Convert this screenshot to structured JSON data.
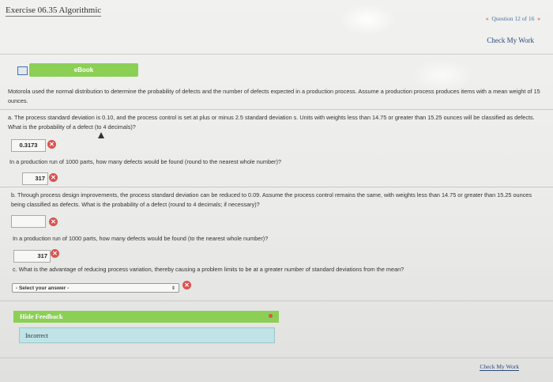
{
  "header": {
    "title": "Exercise 06.35 Algorithmic",
    "question_nav": {
      "prev": "«",
      "label": "Question 12 of 16",
      "next": "»"
    },
    "check_my_work": "Check My Work"
  },
  "ebook": {
    "label": "eBook"
  },
  "intro": "Motorola used the normal distribution to determine the probability of defects and the number of defects expected in a production process. Assume a production process produces items with a mean weight of 15 ounces.",
  "part_a": {
    "text": "a. The process standard deviation is 0.10, and the process control is set at plus or minus 2.5 standard deviation s. Units with weights less than 14.75 or greater than 15.25 ounces will be classified as defects. What is the probability of a defect (to 4 decimals)?",
    "answer": "0.3173",
    "q2": "In a production run of 1000 parts, how many defects would be found (round to the nearest whole number)?",
    "answer2": "317"
  },
  "part_b": {
    "text": "b. Through process design improvements, the process standard deviation can be reduced to 0.09. Assume the process control remains the same, with weights less than 14.75 or greater than 15.25 ounces being classified as defects. What is the probability of a defect (round to 4 decimals; if necessary)?",
    "answer": "",
    "q2": "In a production run of 1000 parts, how many defects would be found (to the nearest whole number)?",
    "answer2": "317"
  },
  "part_c": {
    "text": "c. What is the advantage of reducing process variation, thereby causing a problem limits to be at a greater number of standard deviations from the mean?",
    "select_value": "- Select your answer -"
  },
  "feedback": {
    "toggle_label": "Hide Feedback",
    "body": "Incorrect"
  },
  "footer": {
    "check_my_work": "Check My Work"
  },
  "colors": {
    "accent_green": "#8ccf55",
    "error_red": "#d9534f",
    "feedback_bg": "#bfe3e6",
    "link_blue": "#2c4a7a"
  },
  "icons": {
    "error": "x-circle-icon",
    "ebook": "book-icon",
    "select": "up-down-arrows-icon"
  }
}
